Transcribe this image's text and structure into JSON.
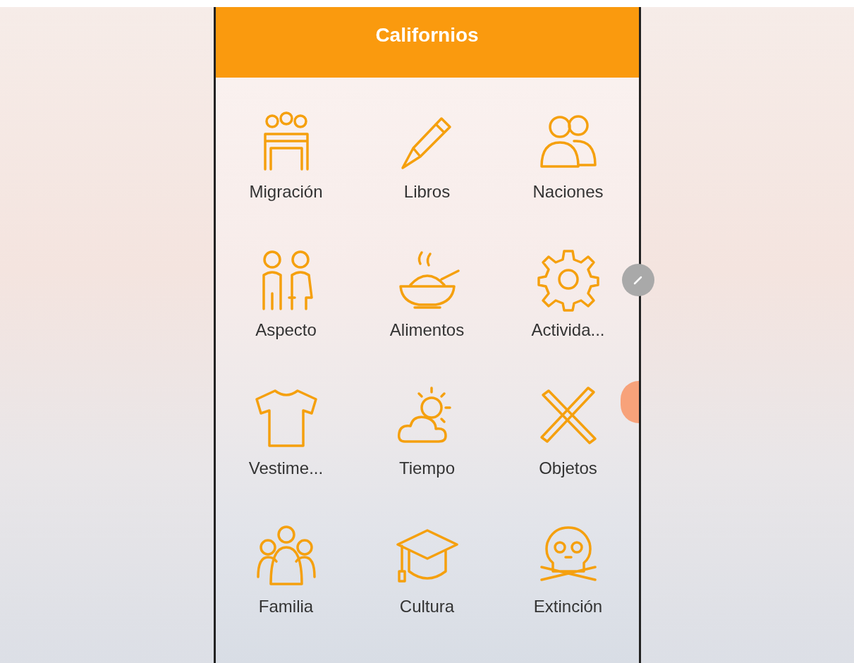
{
  "app_bar": {
    "title": "Californios"
  },
  "categories": [
    {
      "label": "Migración",
      "kind": "group"
    },
    {
      "label": "Libros",
      "kind": "pen"
    },
    {
      "label": "Naciones",
      "kind": "pair"
    },
    {
      "label": "Aspecto",
      "kind": "couple"
    },
    {
      "label": "Alimentos",
      "kind": "bowl"
    },
    {
      "label": "Activida...",
      "kind": "gear"
    },
    {
      "label": "Vestime...",
      "kind": "shirt"
    },
    {
      "label": "Tiempo",
      "kind": "weather"
    },
    {
      "label": "Objetos",
      "kind": "sticks"
    },
    {
      "label": "Familia",
      "kind": "family"
    },
    {
      "label": "Cultura",
      "kind": "cap"
    },
    {
      "label": "Extinción",
      "kind": "skull"
    }
  ]
}
